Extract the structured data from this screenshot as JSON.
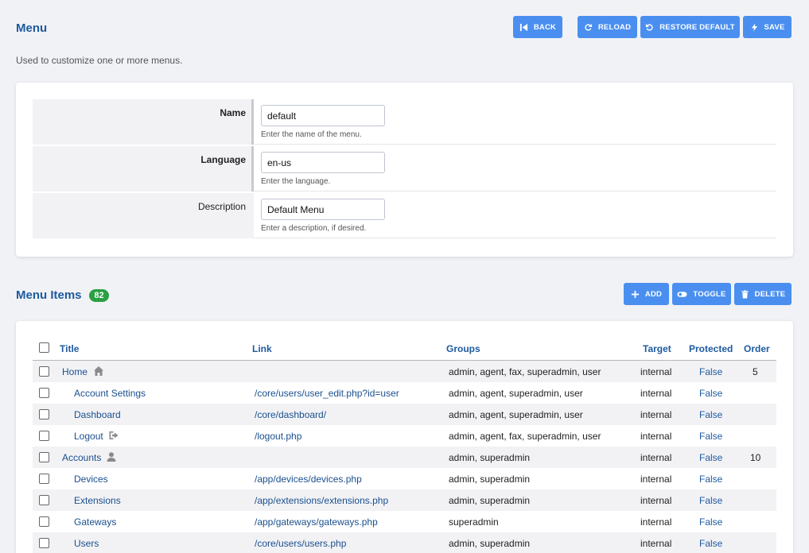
{
  "header": {
    "title": "Menu",
    "subtitle": "Used to customize one or more menus.",
    "buttons": {
      "back": "BACK",
      "reload": "RELOAD",
      "restore_default": "RESTORE DEFAULT",
      "save": "SAVE"
    }
  },
  "form": {
    "name": {
      "label": "Name",
      "value": "default",
      "hint": "Enter the name of the menu."
    },
    "language": {
      "label": "Language",
      "value": "en-us",
      "hint": "Enter the language."
    },
    "description": {
      "label": "Description",
      "value": "Default Menu",
      "hint": "Enter a description, if desired."
    }
  },
  "items_section": {
    "title": "Menu Items",
    "count": "82",
    "buttons": {
      "add": "ADD",
      "toggle": "TOGGLE",
      "delete": "DELETE"
    }
  },
  "table": {
    "headers": {
      "title": "Title",
      "link": "Link",
      "groups": "Groups",
      "target": "Target",
      "protected": "Protected",
      "order": "Order"
    },
    "rows": [
      {
        "title": "Home",
        "icon": "home-icon",
        "link": "",
        "groups": "admin, agent, fax, superadmin, user",
        "target": "internal",
        "protected": "False",
        "order": "5"
      },
      {
        "title": "Account Settings",
        "link": "/core/users/user_edit.php?id=user",
        "groups": "admin, agent, superadmin, user",
        "target": "internal",
        "protected": "False",
        "order": ""
      },
      {
        "title": "Dashboard",
        "link": "/core/dashboard/",
        "groups": "admin, agent, superadmin, user",
        "target": "internal",
        "protected": "False",
        "order": ""
      },
      {
        "title": "Logout",
        "icon": "logout-icon",
        "link": "/logout.php",
        "groups": "admin, agent, fax, superadmin, user",
        "target": "internal",
        "protected": "False",
        "order": ""
      },
      {
        "title": "Accounts",
        "icon": "user-icon",
        "link": "",
        "groups": "admin, superadmin",
        "target": "internal",
        "protected": "False",
        "order": "10"
      },
      {
        "title": "Devices",
        "link": "/app/devices/devices.php",
        "groups": "admin, superadmin",
        "target": "internal",
        "protected": "False",
        "order": ""
      },
      {
        "title": "Extensions",
        "link": "/app/extensions/extensions.php",
        "groups": "admin, superadmin",
        "target": "internal",
        "protected": "False",
        "order": ""
      },
      {
        "title": "Gateways",
        "link": "/app/gateways/gateways.php",
        "groups": "superadmin",
        "target": "internal",
        "protected": "False",
        "order": ""
      },
      {
        "title": "Users",
        "link": "/core/users/users.php",
        "groups": "admin, superadmin",
        "target": "internal",
        "protected": "False",
        "order": ""
      }
    ]
  },
  "colors": {
    "accent": "#4a8ff0",
    "title": "#1e5aa0",
    "badge": "#2aa043"
  }
}
